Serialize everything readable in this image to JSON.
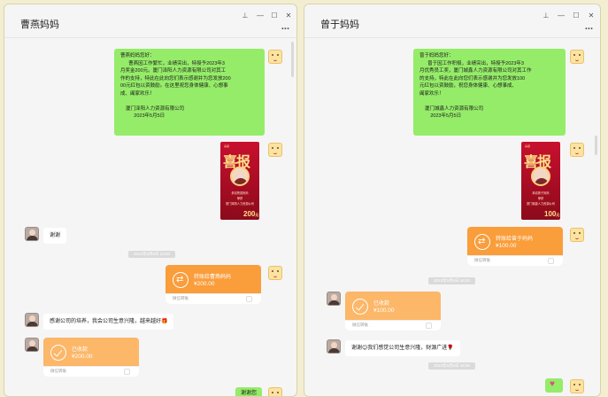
{
  "left": {
    "title": "曹燕妈妈",
    "controls": [
      "⊥",
      "—",
      "☐",
      "✕"
    ],
    "more": "...",
    "announcement": "曹燕妈妈您好：\n      曹燕因工作繁忙，业绩突出，特授予2023年3\n月奖金200元。厦门泽阳人力资源有限公司对其工\n作的支持，特此在此向您们表示感谢并为您发放200\n00元红包以资鼓励。在这里祝您身体健康、心想事\n成、阖家欢乐！\n\n    厦门泽阳人力资源有限公司\n          2023年5月5日",
    "poster": {
      "top": "喜报",
      "title": "喜报",
      "line1": "恭喜曹燕妈妈",
      "line2": "荣获",
      "line3": "厦门泽阳人力资源公司",
      "amount": "200",
      "unit": "元"
    },
    "reply_msg": "谢谢",
    "time1": "2023年5月5日 12:00",
    "transfer_sent": {
      "label": "转账给曹燕妈妈",
      "amount": "¥200.00",
      "footer": "微信转账"
    },
    "thanks_msg": "感谢公司的培养，我会公司生意兴隆，越来越好🎁",
    "transfer_recv": {
      "label": "已收款",
      "amount": "¥200.00",
      "footer": "微信转账"
    },
    "last_msg": "谢谢您"
  },
  "right": {
    "title": "曾于妈妈",
    "controls": [
      "⊥",
      "—",
      "☐",
      "✕"
    ],
    "more": "...",
    "announcement": "曾于妈妈您好：\n      曾于因工作积极，业绩突出，特授予2023年3\n月优秀员工奖，厦门城鑫人力资源有限公司对其工作\n的支持，特此在此向您们表示感谢并为您发放100\n元红包以资鼓励，祝您身体健康、心想事成、\n阖家欢乐！\n\n    厦门城鑫人力资源有限公司\n        2023年5月5日",
    "poster": {
      "top": "喜报",
      "title": "喜报",
      "line1": "恭喜曾于妈妈",
      "line2": "荣获",
      "line3": "厦门城鑫人力资源公司",
      "amount": "100",
      "unit": "元"
    },
    "transfer_sent": {
      "label": "转账给曾于妈妈",
      "amount": "¥100.00",
      "footer": "微信转账"
    },
    "time1": "2023年5月5日 16:53",
    "transfer_recv": {
      "label": "已收款",
      "amount": "¥100.00",
      "footer": "微信转账"
    },
    "thanks_msg": "谢谢😊我们感觉公司生意兴隆，财源广进🌹",
    "time2": "2023年5月5日 16:55"
  }
}
